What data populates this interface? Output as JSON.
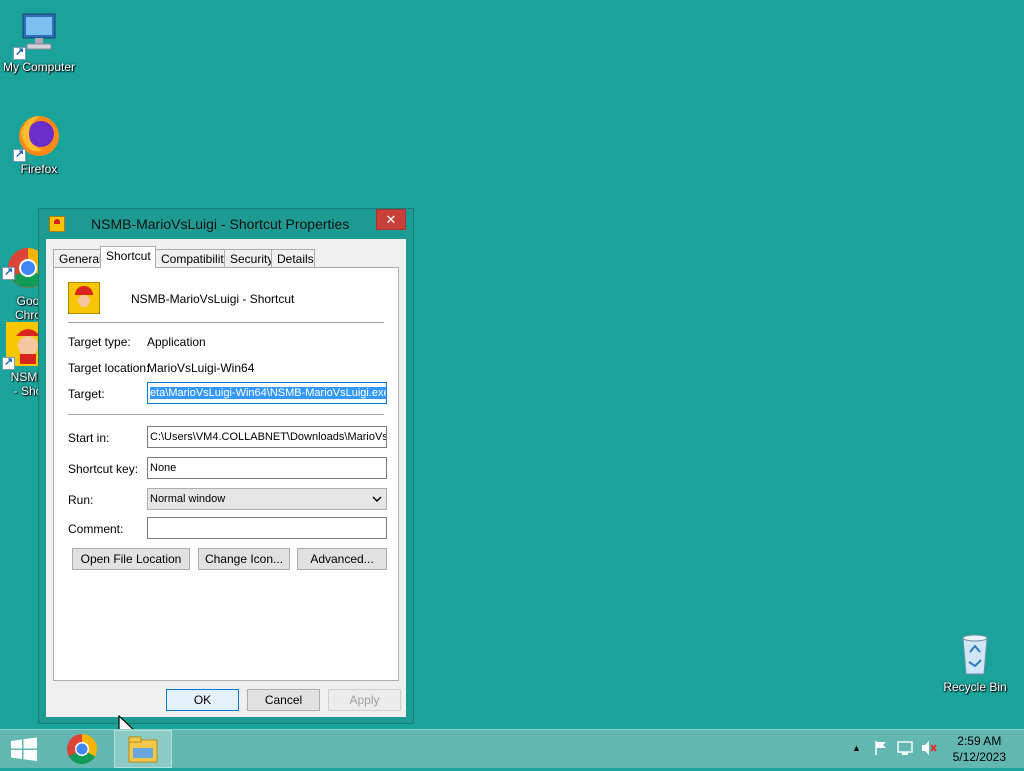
{
  "desktop": {
    "icons": [
      {
        "label": "My Computer"
      },
      {
        "label": "Firefox"
      },
      {
        "label": "Goo\nChro"
      },
      {
        "label": "NSMB\n- Sho"
      },
      {
        "label": "Recycle Bin"
      }
    ]
  },
  "dialog": {
    "title": "NSMB-MarioVsLuigi - Shortcut Properties",
    "close_label": "✕",
    "tabs": [
      "General",
      "Shortcut",
      "Compatibility",
      "Security",
      "Details"
    ],
    "active_tab": "Shortcut",
    "shortcut_name": "NSMB-MarioVsLuigi - Shortcut",
    "target_type_label": "Target type:",
    "target_type_value": "Application",
    "target_location_label": "Target location:",
    "target_location_value": "MarioVsLuigi-Win64",
    "target_label": "Target:",
    "target_value": "eta\\MarioVsLuigi-Win64\\NSMB-MarioVsLuigi.exe",
    "start_in_label": "Start in:",
    "start_in_value": "C:\\Users\\VM4.COLLABNET\\Downloads\\MarioVs",
    "shortcut_key_label": "Shortcut key:",
    "shortcut_key_value": "None",
    "run_label": "Run:",
    "run_value": "Normal window",
    "comment_label": "Comment:",
    "comment_value": "",
    "open_file_location": "Open File Location",
    "change_icon": "Change Icon...",
    "advanced": "Advanced...",
    "ok": "OK",
    "cancel": "Cancel",
    "apply": "Apply"
  },
  "taskbar": {
    "time": "2:59 AM",
    "date": "5/12/2023",
    "tray_chevron": "▲"
  },
  "colors": {
    "desktop": "#1aa39a",
    "taskbar": "#62b8b0",
    "close_button": "#c7413a",
    "selection": "#3399ff"
  }
}
